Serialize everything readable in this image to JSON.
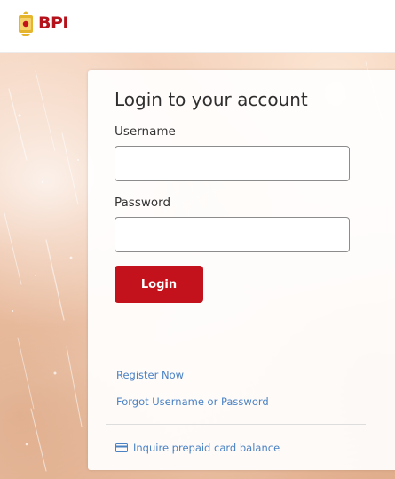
{
  "brand": {
    "name": "BPI",
    "primary_color": "#c4121c",
    "crest_color": "#e6b52e",
    "link_color": "#4a82c4"
  },
  "login": {
    "title": "Login to your account",
    "username_label": "Username",
    "username_value": "",
    "password_label": "Password",
    "password_value": "",
    "login_button": "Login"
  },
  "links": {
    "register": "Register Now",
    "forgot": "Forgot Username or Password",
    "prepaid": "Inquire prepaid card balance",
    "prepaid_icon": "credit-card-icon"
  }
}
